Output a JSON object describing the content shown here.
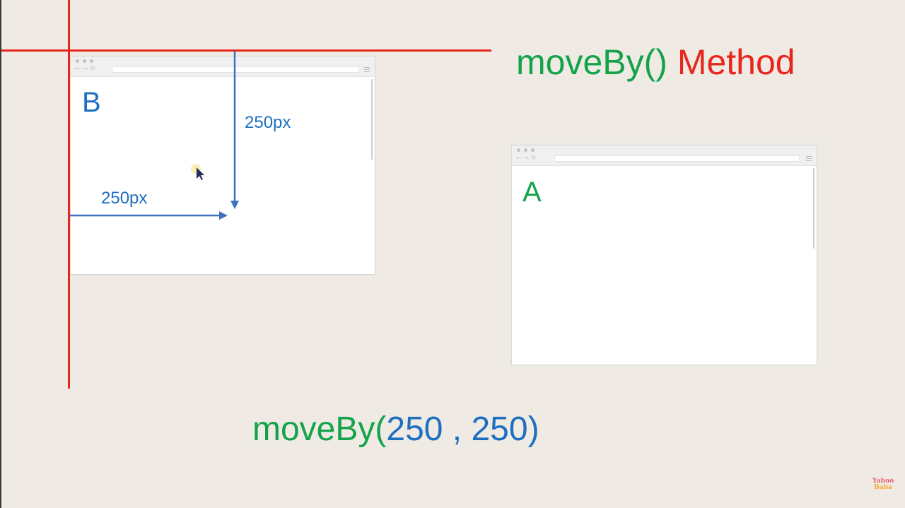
{
  "title": {
    "function": "moveBy()",
    "word": "Method"
  },
  "browser_b": {
    "letter": "B"
  },
  "browser_a": {
    "letter": "A"
  },
  "offsets": {
    "vertical_label": "250px",
    "horizontal_label": "250px"
  },
  "call": {
    "prefix": "moveBy(",
    "x": "250",
    "separator": " , ",
    "y": "250",
    "suffix": ")"
  },
  "watermark": {
    "line1": "Yahoo",
    "line2": "Baba"
  },
  "colors": {
    "green": "#14a34a",
    "red": "#e8261c",
    "blue": "#1f6fc0",
    "background": "#efebe4"
  },
  "icons": [
    "cursor-icon",
    "back-arrow-icon",
    "forward-arrow-icon",
    "reload-icon",
    "menu-icon"
  ]
}
